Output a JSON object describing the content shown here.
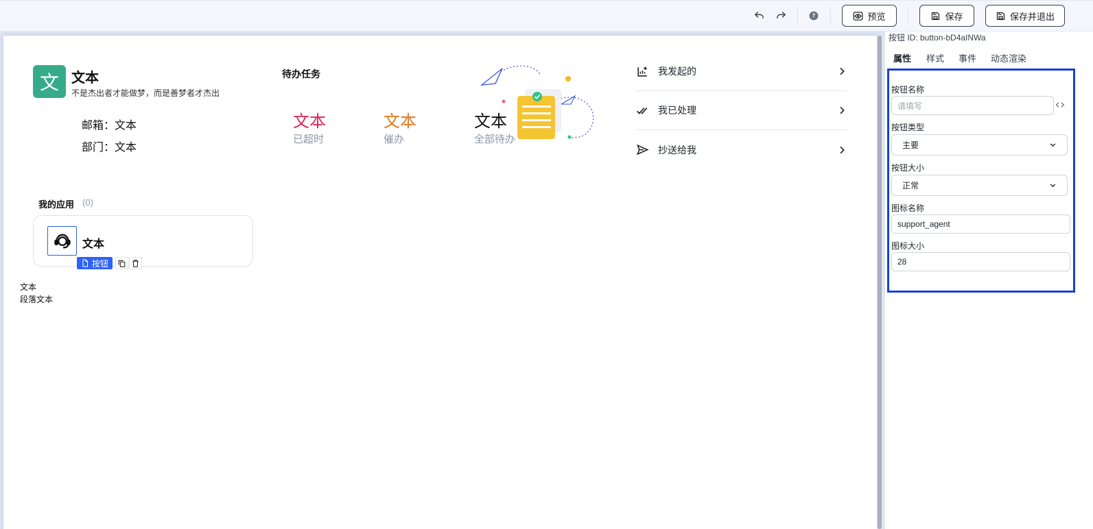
{
  "toolbar": {
    "undo_icon": "undo-icon",
    "redo_icon": "redo-icon",
    "help_icon": "help-icon",
    "preview_label": "预览",
    "save_label": "保存",
    "save_exit_label": "保存并退出"
  },
  "profile": {
    "avatar_char": "文",
    "name": "文本",
    "motto": "不是杰出者才能做梦，而是善梦者才杰出",
    "email_line": "邮箱：文本",
    "dept_line": "部门：文本"
  },
  "todo": {
    "title": "待办任务",
    "stats": [
      {
        "value": "文本",
        "label": "已超时",
        "color": "#e02454"
      },
      {
        "value": "文本",
        "label": "催办",
        "color": "#e0781c"
      },
      {
        "value": "文本",
        "label": "全部待办",
        "color": "#111111"
      }
    ]
  },
  "quick_links": [
    {
      "label": "我发起的",
      "icon": "chart-add-icon"
    },
    {
      "label": "我已处理",
      "icon": "double-check-icon"
    },
    {
      "label": "抄送给我",
      "icon": "send-icon"
    }
  ],
  "apps": {
    "title": "我的应用",
    "count": "(0)",
    "item_name": "文本",
    "item_icon": "support-agent-icon",
    "selected_tag": "按钮"
  },
  "extra_text": {
    "line1": "文本",
    "line2": "段落文本"
  },
  "panel": {
    "button_id": "按钮 ID:  button-bD4aINWa",
    "tabs": [
      "属性",
      "样式",
      "事件",
      "动态渲染"
    ],
    "fields": {
      "name_label": "按钮名称",
      "name_placeholder": "请填写",
      "type_label": "按钮类型",
      "type_value": "主要",
      "size_label": "按钮大小",
      "size_value": "正常",
      "icon_label": "图标名称",
      "icon_value": "support_agent",
      "icon_size_label": "图标大小",
      "icon_size_value": "28"
    }
  },
  "colors": {
    "accent": "#2f63f5",
    "avatar_bg": "#36ab8a",
    "highlight_border": "#1a3fd1"
  }
}
